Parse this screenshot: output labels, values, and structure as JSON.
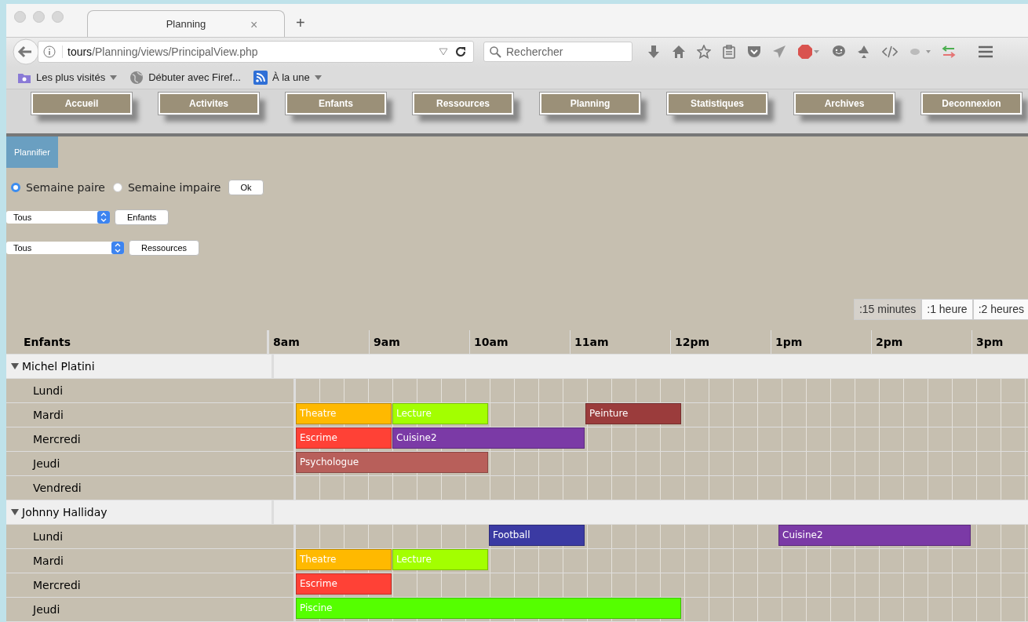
{
  "browser": {
    "tab_title": "Planning",
    "tab_close": "×",
    "new_tab": "+",
    "url_host": "tours",
    "url_path": "/Planning/views/PrincipalView.php",
    "search_placeholder": "Rechercher",
    "bookmarks": [
      {
        "label": "Les plus visités",
        "kind": "folder",
        "dropdown": true
      },
      {
        "label": "Débuter avec Firef...",
        "kind": "globe",
        "dropdown": false
      },
      {
        "label": "À la une",
        "kind": "feed",
        "dropdown": true
      }
    ]
  },
  "nav": [
    "Accueil",
    "Activites",
    "Enfants",
    "Ressources",
    "Planning",
    "Statistiques",
    "Archives",
    "Deconnexion"
  ],
  "tabs": [
    {
      "label": "Plannifier",
      "selected": true
    }
  ],
  "week": [
    {
      "label": "Semaine paire",
      "selected": true
    },
    {
      "label": "Semaine impaire",
      "selected": false
    }
  ],
  "ok": "Ok",
  "filters": [
    {
      "value": "Tous",
      "button": "Enfants"
    },
    {
      "value": "Tous",
      "button": "Ressources"
    }
  ],
  "scales": [
    {
      "label": ":15 minutes",
      "selected": true
    },
    {
      "label": ":1 heure",
      "selected": false
    },
    {
      "label": ":2 heures",
      "selected": false
    }
  ],
  "timeline": {
    "heading": "Enfants",
    "hours": [
      "8am",
      "9am",
      "10am",
      "11am",
      "12pm",
      "1pm",
      "2pm",
      "3pm"
    ],
    "groups": [
      {
        "name": "Michel Platini",
        "expanded": true,
        "days": [
          {
            "day": "Lundi"
          },
          {
            "day": "Mardi",
            "blocks": [
              {
                "kind": "event",
                "label": "Theatre",
                "color": "#ffb900"
              },
              {
                "kind": "event",
                "label": "Lecture",
                "color": "#a3ff00"
              },
              {
                "kind": "free"
              },
              {
                "kind": "event",
                "label": "Peinture",
                "color": "#9b3c3c"
              }
            ]
          },
          {
            "day": "Mercredi",
            "blocks": [
              {
                "kind": "event",
                "label": "Escrime",
                "color": "#ff4136"
              },
              {
                "kind": "event",
                "label": "Cuisine2",
                "color": "#7b3aa6"
              },
              {
                "kind": "continued"
              }
            ]
          },
          {
            "day": "Jeudi",
            "blocks": [
              {
                "kind": "event",
                "label": "Psychologue",
                "color": "#b85f5a"
              },
              {
                "kind": "continued"
              }
            ]
          },
          {
            "day": "Vendredi"
          }
        ]
      },
      {
        "name": "Johnny Halliday",
        "expanded": true,
        "days": [
          {
            "day": "Lundi",
            "blocks": [
              {
                "kind": "free"
              },
              {
                "kind": "free"
              },
              {
                "kind": "event",
                "label": "Football",
                "color": "#3b3aa3"
              },
              {
                "kind": "free"
              },
              {
                "kind": "free"
              },
              {
                "kind": "event",
                "label": "Cuisine2",
                "color": "#7b3aa6"
              },
              {
                "kind": "continued"
              }
            ]
          },
          {
            "day": "Mardi",
            "blocks": [
              {
                "kind": "event",
                "label": "Theatre",
                "color": "#ffb900"
              },
              {
                "kind": "event",
                "label": "Lecture",
                "color": "#a3ff00"
              }
            ]
          },
          {
            "day": "Mercredi",
            "blocks": [
              {
                "kind": "event",
                "label": "Escrime",
                "color": "#ff4136"
              }
            ]
          },
          {
            "day": "Jeudi",
            "blocks": [
              {
                "kind": "event",
                "label": "Piscine",
                "color": "#55ff00"
              },
              {
                "kind": "continued"
              },
              {
                "kind": "continued"
              },
              {
                "kind": "continued"
              }
            ]
          }
        ]
      }
    ]
  }
}
